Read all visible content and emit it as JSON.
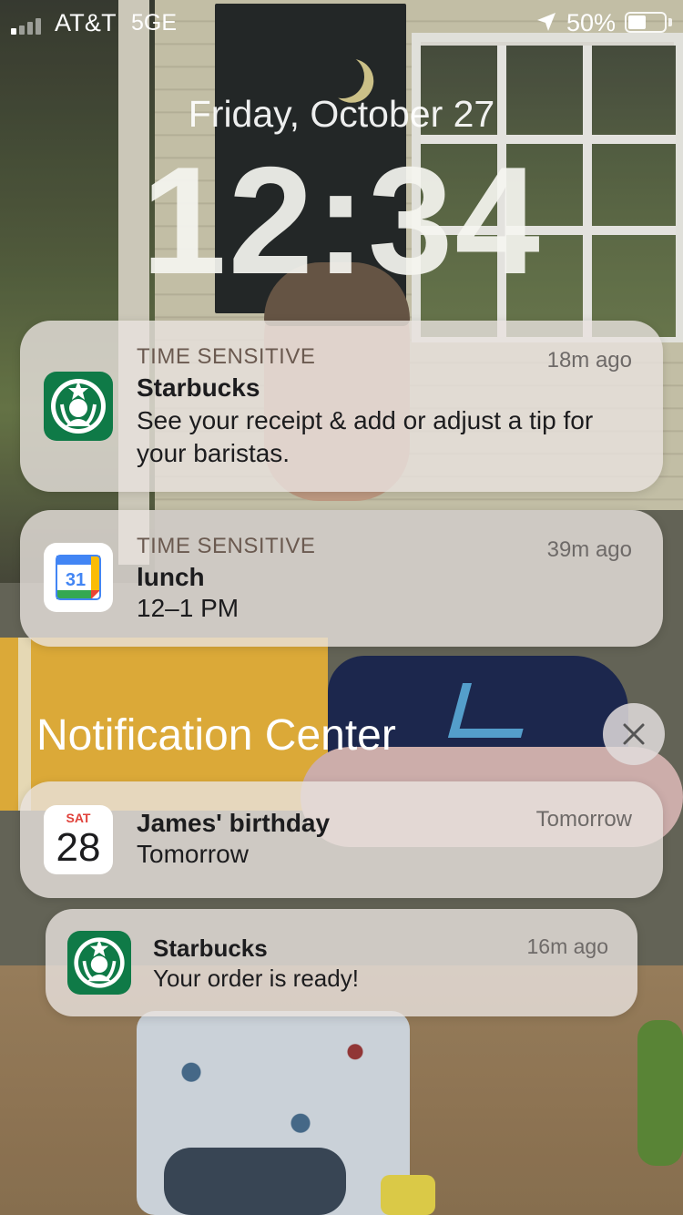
{
  "status_bar": {
    "carrier": "AT&T",
    "network": "5GE",
    "battery_percent": "50%",
    "battery_level": 0.5
  },
  "lock_screen": {
    "date": "Friday, October 27",
    "time": "12:34"
  },
  "notifications": [
    {
      "app": "Starbucks",
      "icon": "starbucks-icon",
      "label": "TIME SENSITIVE",
      "title": "Starbucks",
      "body": "See your receipt & add or adjust a tip for your baristas.",
      "time": "18m ago"
    },
    {
      "app": "Google Calendar",
      "icon": "google-calendar-icon",
      "icon_text": "31",
      "label": "TIME SENSITIVE",
      "title": "lunch",
      "body": "12–1 PM",
      "time": "39m ago"
    }
  ],
  "notification_center": {
    "title": "Notification Center",
    "items": [
      {
        "app": "Calendar",
        "icon": "calendar-icon",
        "icon_day": "SAT",
        "icon_date": "28",
        "title": "James' birthday",
        "body": "Tomorrow",
        "time": "Tomorrow"
      },
      {
        "app": "Starbucks",
        "icon": "starbucks-icon",
        "title": "Starbucks",
        "body": "Your order is ready!",
        "time": "16m ago"
      }
    ]
  },
  "colors": {
    "starbucks_green": "#0f7a47",
    "calendar_red": "#e0413a",
    "google_blue": "#4285f4"
  }
}
